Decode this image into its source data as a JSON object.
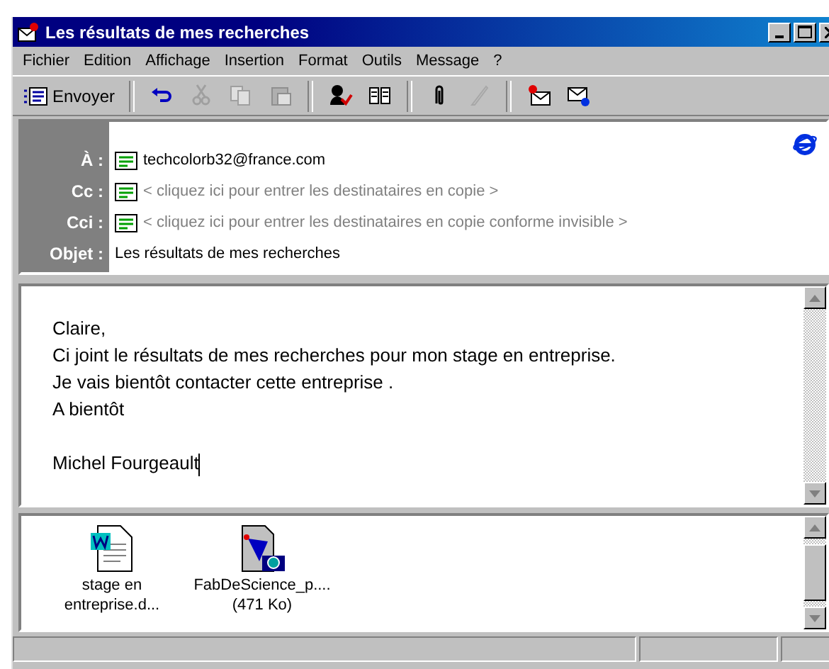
{
  "window": {
    "title": "Les résultats de mes recherches"
  },
  "menu": [
    "Fichier",
    "Edition",
    "Affichage",
    "Insertion",
    "Format",
    "Outils",
    "Message",
    "?"
  ],
  "toolbar": {
    "send": {
      "label": "Envoyer"
    },
    "tool_groups": [
      [
        {
          "disabled": false
        },
        {
          "disabled": true
        },
        {
          "disabled": true
        },
        {
          "disabled": true
        }
      ],
      [
        {
          "disabled": false
        },
        {
          "disabled": false
        }
      ],
      [
        {
          "disabled": false
        },
        {
          "disabled": true
        }
      ],
      [
        {
          "disabled": false
        },
        {
          "disabled": false
        }
      ]
    ]
  },
  "header": [
    {
      "label": "À :",
      "value": "techcolorb32@france.com",
      "placeholder": false,
      "kind": "recipient"
    },
    {
      "label": "Cc :",
      "value": "< cliquez ici pour entrer les destinataires en copie >",
      "placeholder": true,
      "kind": "recipient"
    },
    {
      "label": "Cci :",
      "value": "< cliquez ici pour entrer les destinataires en copie conforme invisible >",
      "placeholder": true,
      "kind": "recipient"
    },
    {
      "label": "Objet :",
      "value": "Les résultats de mes recherches",
      "placeholder": false,
      "kind": "subject"
    }
  ],
  "body": {
    "paragraphs": [
      [
        "Claire,",
        "Ci joint le résultats de mes recherches pour mon stage en entreprise.",
        "Je vais bientôt contacter cette entreprise .",
        "A bientôt"
      ],
      [
        "Michel Fourgeault"
      ]
    ]
  },
  "attachments": [
    {
      "kind": "document",
      "lines": [
        "stage en",
        "entreprise.d..."
      ]
    },
    {
      "kind": "image",
      "lines": [
        "FabDeScience_p....",
        "(471 Ko)"
      ]
    }
  ]
}
